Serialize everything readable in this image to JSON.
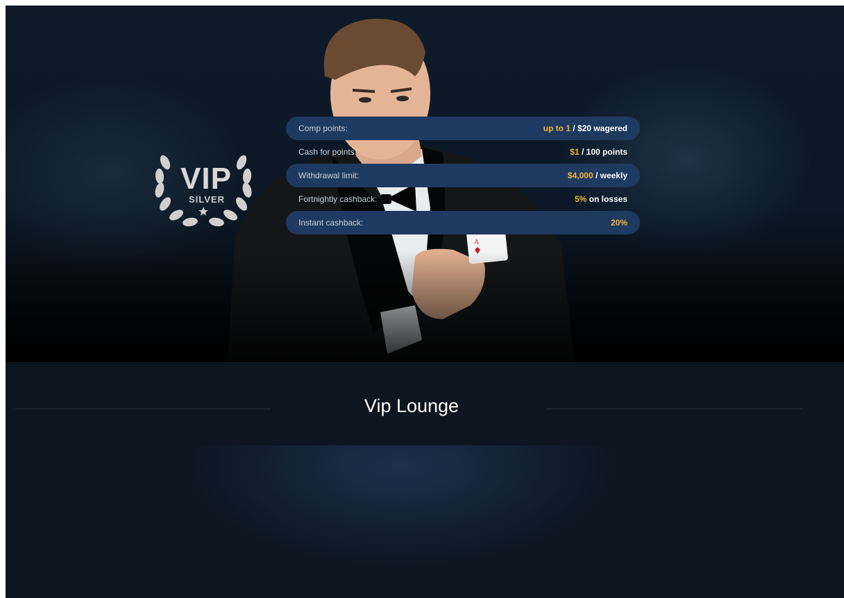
{
  "page": {
    "title": "Vip Lounge"
  },
  "badge": {
    "main": "VIP",
    "tier": "SILVER"
  },
  "benefits": [
    {
      "label": "Comp points:",
      "highlight": "up to 1",
      "rest": " / $20 wagered"
    },
    {
      "label": "Cash for points:",
      "highlight": "$1",
      "rest": " / 100 points"
    },
    {
      "label": "Withdrawal limit:",
      "highlight": "$4,000",
      "rest": " / weekly"
    },
    {
      "label": "Fortnightly cashback:",
      "highlight": "5%",
      "rest": " on losses"
    },
    {
      "label": "Instant cashback:",
      "highlight": "20%",
      "rest": ""
    }
  ],
  "colors": {
    "accent": "#f2b637",
    "row_stripe": "#1f3a60",
    "background": "#0d1520"
  }
}
